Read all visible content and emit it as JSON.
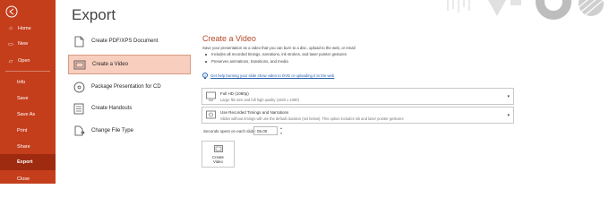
{
  "nav": {
    "items": [
      {
        "label": "Home",
        "icon": "home-icon",
        "glyph": "⌂"
      },
      {
        "label": "New",
        "icon": "new-document-icon",
        "glyph": "▭"
      },
      {
        "label": "Open",
        "icon": "open-folder-icon",
        "glyph": "▱"
      },
      {
        "label": "Info"
      },
      {
        "label": "Save"
      },
      {
        "label": "Save As"
      },
      {
        "label": "Print"
      },
      {
        "label": "Share"
      },
      {
        "label": "Export"
      },
      {
        "label": "Close"
      }
    ],
    "active": "Export",
    "colors": {
      "background": "#c43e1c",
      "active": "#9e2a10"
    }
  },
  "page_title": "Export",
  "options": [
    {
      "label": "Create PDF/XPS Document",
      "icon": "pdf-document-icon"
    },
    {
      "label": "Create a Video",
      "icon": "video-icon"
    },
    {
      "label": "Package Presentation for CD",
      "icon": "cd-package-icon"
    },
    {
      "label": "Create Handouts",
      "icon": "handouts-icon"
    },
    {
      "label": "Change File Type",
      "icon": "file-type-icon"
    }
  ],
  "detail": {
    "title": "Create a Video",
    "description": "Save your presentation as a video that you can burn to a disc, upload to the web, or email",
    "bullets": [
      "Includes all recorded timings, narrations, ink strokes, and laser pointer gestures",
      "Preserves animations, transitions, and media"
    ],
    "help_link": "Get help burning your slide show video to DVD or uploading it to the web",
    "quality": {
      "title": "Full HD (1080p)",
      "subtitle": "Large file size and full high quality (1920 x 1080)"
    },
    "timings": {
      "title": "Use Recorded Timings and Narrations",
      "subtitle": "Slides without timings will use the default duration (set below). This option includes ink and laser pointer gestures"
    },
    "seconds_label": "Seconds spent on each slide:",
    "seconds_value": "05.00",
    "create_button": {
      "line1": "Create",
      "line2": "Video"
    }
  },
  "accent": "#b7472a"
}
